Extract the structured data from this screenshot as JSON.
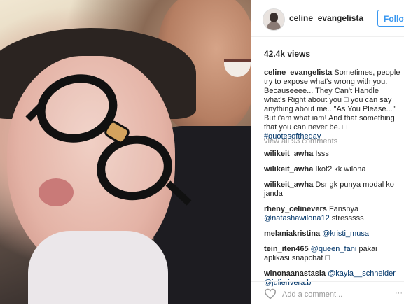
{
  "post": {
    "username": "celine_evangelista",
    "follow_label": "Follow",
    "views": "42.4k views",
    "caption": {
      "username": "celine_evangelista",
      "text": " Sometimes, people try to expose what's wrong with you. Becauseeee... They Can't Handle what's Right about you □ you can say anything about me.. \"As You Please...\" But i'am what iam! And that something that you can never be. □ ",
      "hashtag": "#quotesoftheday"
    },
    "view_all_comments": "view all 93 comments",
    "comments": [
      {
        "user": "wilikeit_awha",
        "text": " Isss",
        "mention": ""
      },
      {
        "user": "wilikeit_awha",
        "text": " Ikot2 kk wilona",
        "mention": ""
      },
      {
        "user": "wilikeit_awha",
        "text": " Dsr gk punya modal ko janda",
        "mention": ""
      },
      {
        "user": "rheny_celinevers",
        "text": " Fansnya ",
        "mention": "@natashawilona12",
        "after": " stresssss"
      },
      {
        "user": "melaniakristina",
        "text": " ",
        "mention": "@kristi_musa"
      },
      {
        "user": "tein_iten465",
        "text": " ",
        "mention": "@queen_fani",
        "after": " pakai aplikasi snapchat □"
      },
      {
        "user": "winonaanastasia",
        "text": " ",
        "mention": "@kayla__schneider",
        "after": " ",
        "mention2": "@julierivera.b"
      }
    ],
    "add_comment_placeholder": "Add a comment...",
    "more_label": "···"
  }
}
